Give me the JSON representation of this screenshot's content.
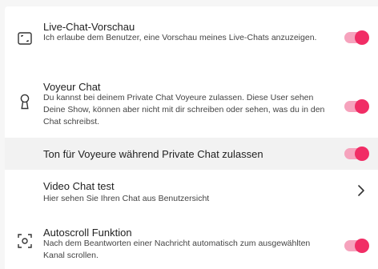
{
  "settings": {
    "items": [
      {
        "title": "Live-Chat-Vorschau",
        "description": "Ich erlaube dem Benutzer, eine Vorschau meines Live-Chats anzuzeigen.",
        "icon": "fullscreen-icon",
        "toggle_on": true
      },
      {
        "title": "Voyeur Chat",
        "description": "Du kannst bei deinem Private Chat Voyeure zulassen. Diese User sehen Deine Show, können aber nicht mit dir schreiben oder sehen, was du in den Chat schreibst.",
        "icon": "keyhole-icon",
        "toggle_on": true
      },
      {
        "title": "Ton für Voyeure während Private Chat zulassen",
        "toggle_on": true
      },
      {
        "title": "Video Chat test",
        "description": "Hier sehen Sie Ihren Chat aus Benutzersicht",
        "icon": "chevron-right-icon"
      },
      {
        "title": "Autoscroll Funktion",
        "description": "Nach dem Beantworten einer Nachricht automatisch zum ausgewählten Kanal scrollen.",
        "icon": "focus-icon",
        "toggle_on": true
      }
    ]
  },
  "colors": {
    "toggle_on": "#f12d65",
    "toggle_track": "#f6a3bd",
    "highlight_row": "#f2f2f2"
  }
}
